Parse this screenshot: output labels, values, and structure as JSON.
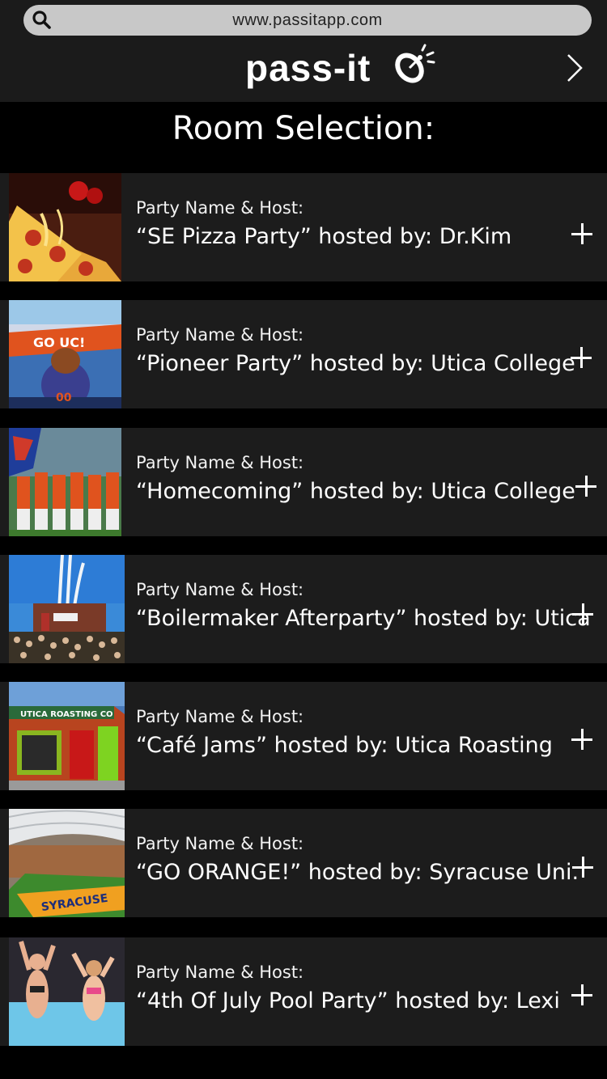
{
  "browser": {
    "url": "www.passitapp.com",
    "search_icon": "search-icon"
  },
  "header": {
    "brand": "pass-it",
    "brand_icon": "satellite-dish-icon",
    "next_icon": "chevron-right-icon"
  },
  "page_title": "Room Selection:",
  "rooms": [
    {
      "label": "Party Name & Host:",
      "name": "“SE Pizza Party” hosted by: Dr.Kim",
      "thumb": "pizza-photo"
    },
    {
      "label": "Party Name & Host:",
      "name": "“Pioneer Party” hosted by: Utica College",
      "thumb": "mascot-photo"
    },
    {
      "label": "Party Name & Host:",
      "name": "“Homecoming” hosted by: Utica College",
      "thumb": "football-team-photo"
    },
    {
      "label": "Party Name & Host:",
      "name": "“Boilermaker Afterparty” hosted by: Utica",
      "thumb": "crowd-photo"
    },
    {
      "label": "Party Name & Host:",
      "name": "“Café Jams” hosted by: Utica Roasting",
      "thumb": "coffee-shop-photo"
    },
    {
      "label": "Party Name & Host:",
      "name": "“GO ORANGE!” hosted by: Syracuse Uni.",
      "thumb": "stadium-photo"
    },
    {
      "label": "Party Name & Host:",
      "name": "“4th Of July Pool Party” hosted by: Lexi",
      "thumb": "pool-party-photo"
    }
  ],
  "colors": {
    "background": "#000000",
    "row": "#1c1c1c",
    "topbar": "#1b1b1b",
    "urlbar": "#c8c8c8"
  }
}
